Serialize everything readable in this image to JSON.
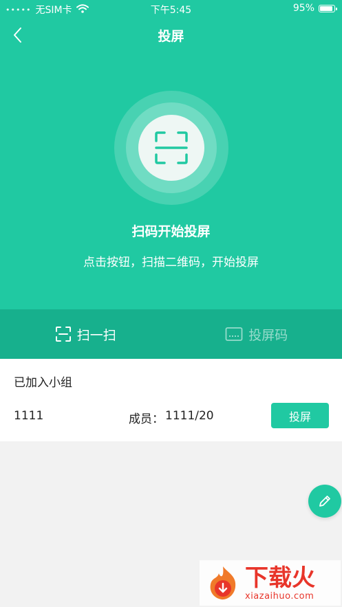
{
  "status_bar": {
    "signal_dots": "•••••",
    "carrier": "无SIM卡",
    "time": "下午5:45",
    "battery": "95%"
  },
  "navbar": {
    "title": "投屏"
  },
  "hero": {
    "headline": "扫码开始投屏",
    "subline": "点击按钮，扫描二维码，开始投屏"
  },
  "tabs": [
    {
      "label": "扫一扫",
      "icon": "scan-icon",
      "active": true
    },
    {
      "label": "投屏码",
      "icon": "keyboard-icon",
      "active": false
    }
  ],
  "group": {
    "title": "已加入小组",
    "name": "1111",
    "members_label": "成员：",
    "members_value": "1111/20",
    "cast_button": "投屏"
  },
  "watermark": {
    "brand": "下载火",
    "url": "xiazaihuo.com"
  },
  "colors": {
    "primary": "#20c9a2",
    "tab_bar": "#17b08d",
    "background": "#f2f2f2",
    "watermark": "#e8352a"
  }
}
